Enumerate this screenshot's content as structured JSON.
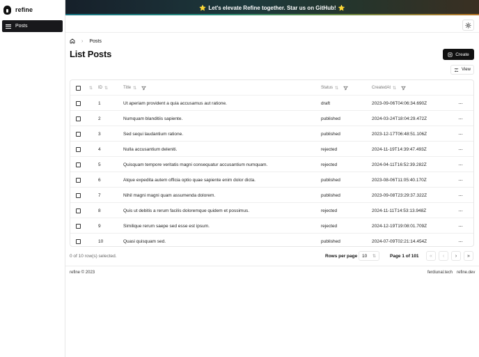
{
  "sidebar": {
    "brand": "refine",
    "nav_items": [
      {
        "label": "Posts",
        "icon": "list-icon"
      }
    ]
  },
  "banner": {
    "text": "Let's elevate Refine together. Star us on GitHub!",
    "star": "⭐"
  },
  "breadcrumb": {
    "current": "Posts"
  },
  "page": {
    "title": "List Posts",
    "create_label": "Create",
    "view_label": "View"
  },
  "table": {
    "columns": [
      "ID",
      "Title",
      "Status",
      "CreatedAt"
    ],
    "rows": [
      {
        "id": "1",
        "title": "Ut aperiam provident a quia accusamus aut ratione.",
        "status": "draft",
        "created": "2023-09-06T04:06:34.690Z"
      },
      {
        "id": "2",
        "title": "Numquam blanditiis sapiente.",
        "status": "published",
        "created": "2024-03-24T18:04:29.472Z"
      },
      {
        "id": "3",
        "title": "Sed sequi laudantium ratione.",
        "status": "published",
        "created": "2023-12-17T06:48:51.106Z"
      },
      {
        "id": "4",
        "title": "Nulla accusantium deleniti.",
        "status": "rejected",
        "created": "2024-11-19T14:39:47.493Z"
      },
      {
        "id": "5",
        "title": "Quisquam tempore veritatis magni consequatur accusantium numquam.",
        "status": "rejected",
        "created": "2024-04-11T16:52:39.282Z"
      },
      {
        "id": "6",
        "title": "Atque expedita autem officia optio quae sapiente enim dolor dicta.",
        "status": "published",
        "created": "2023-08-06T11:05:40.170Z"
      },
      {
        "id": "7",
        "title": "Nihil magni magni quam assumenda dolorem.",
        "status": "published",
        "created": "2023-09-08T23:29:37.322Z"
      },
      {
        "id": "8",
        "title": "Quis ut debitis a rerum facilis doloremque quidem et possimus.",
        "status": "rejected",
        "created": "2024-11-11T14:53:13.948Z"
      },
      {
        "id": "9",
        "title": "Similique rerum saepe sed esse est ipsum.",
        "status": "rejected",
        "created": "2024-12-19T19:08:01.709Z"
      },
      {
        "id": "10",
        "title": "Quasi quisquam sed.",
        "status": "published",
        "created": "2024-07-09T02:21:14.454Z"
      }
    ],
    "row_actions": "···"
  },
  "pagination": {
    "selected_text": "0 of 10 row(s) selected.",
    "rows_per_page_label": "Rows per page",
    "rows_per_page_value": "10",
    "page_info": "Page 1 of 101"
  },
  "footer": {
    "copyright": "refine © 2023",
    "link1": "ferdiunal.tech",
    "link2": "refine.dev"
  }
}
